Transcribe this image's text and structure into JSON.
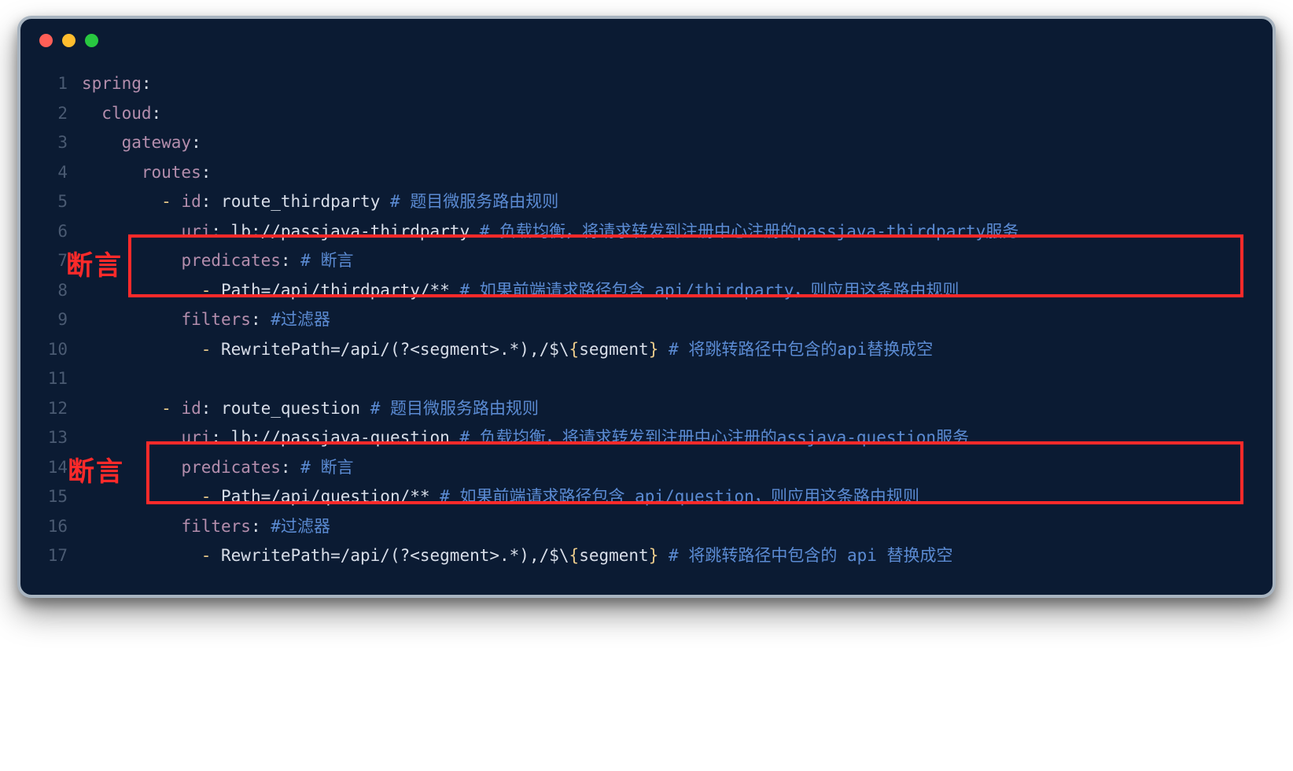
{
  "window": {
    "traffic_lights": {
      "close": "#ff5f57",
      "minimize": "#ffbd2e",
      "zoom": "#28c840"
    }
  },
  "annotations": {
    "label1": "断言",
    "label2": "断言"
  },
  "code": {
    "l1": {
      "k": "spring",
      "colon": ":"
    },
    "l2": {
      "k": "cloud",
      "colon": ":"
    },
    "l3": {
      "k": "gateway",
      "colon": ":"
    },
    "l4": {
      "k": "routes",
      "colon": ":"
    },
    "l5": {
      "dash": "- ",
      "k": "id",
      "colon": ": ",
      "v": "route_thirdparty ",
      "h": "#",
      "c": " 题目微服务路由规则"
    },
    "l6": {
      "k": "uri",
      "colon": ": ",
      "v": "lb://passjava-thirdparty ",
      "h": "#",
      "c": " 负载均衡，将请求转发到注册中心注册的passjava-thirdparty服务"
    },
    "l7": {
      "k": "predicates",
      "colon": ": ",
      "h": "#",
      "c": " 断言"
    },
    "l8": {
      "dash": "- ",
      "v": "Path=/api/thirdparty/** ",
      "h": "#",
      "c": " 如果前端请求路径包含 api/thirdparty，则应用这条路由规则"
    },
    "l9": {
      "k": "filters",
      "colon": ": ",
      "h": "#",
      "c": "过滤器"
    },
    "l10": {
      "dash": "- ",
      "v1": "RewritePath=/api/(?<segment>.*),/$\\",
      "lb": "{",
      "v2": "segment",
      "rb": "}",
      "sp": " ",
      "h": "#",
      "c": " 将跳转路径中包含的api替换成空"
    },
    "l12": {
      "dash": "- ",
      "k": "id",
      "colon": ": ",
      "v": "route_question ",
      "h": "#",
      "c": " 题目微服务路由规则"
    },
    "l13": {
      "k": "uri",
      "colon": ": ",
      "v": "lb://passjava-question ",
      "h": "#",
      "c": " 负载均衡，将请求转发到注册中心注册的assjava-question服务"
    },
    "l14": {
      "k": "predicates",
      "colon": ": ",
      "h": "#",
      "c": " 断言"
    },
    "l15": {
      "dash": "- ",
      "v": "Path=/api/question/** ",
      "h": "#",
      "c": " 如果前端请求路径包含 api/question，则应用这条路由规则"
    },
    "l16": {
      "k": "filters",
      "colon": ": ",
      "h": "#",
      "c": "过滤器"
    },
    "l17": {
      "dash": "- ",
      "v1": "RewritePath=/api/(?<segment>.*),/$\\",
      "lb": "{",
      "v2": "segment",
      "rb": "}",
      "sp": " ",
      "h": "#",
      "c": " 将跳转路径中包含的 api 替换成空"
    }
  }
}
